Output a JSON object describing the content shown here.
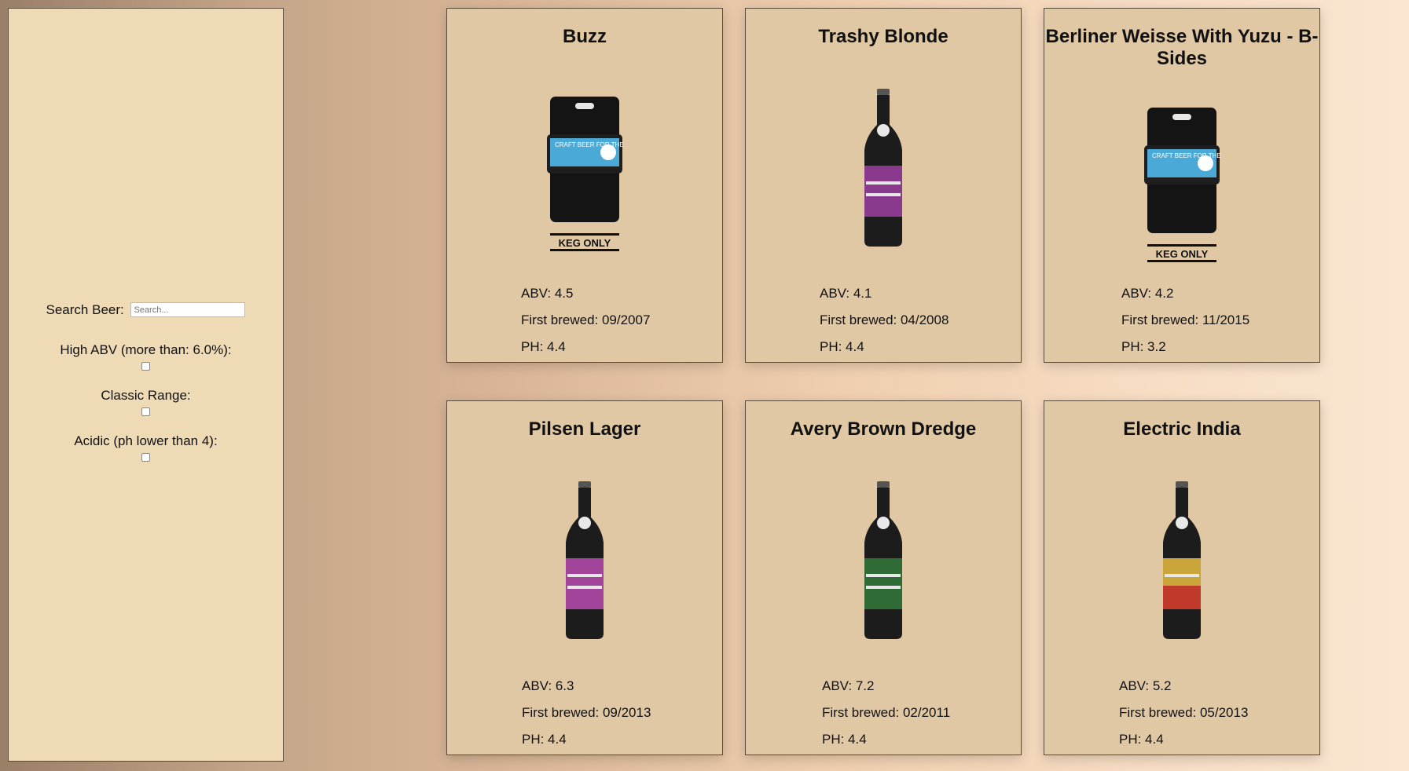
{
  "sidebar": {
    "search_label": "Search Beer:",
    "search_placeholder": "Search...",
    "filters": [
      {
        "label": "High ABV (more than: 6.0%):"
      },
      {
        "label": "Classic Range:"
      },
      {
        "label": "Acidic (ph lower than 4):"
      }
    ]
  },
  "cards": [
    {
      "name": "Buzz",
      "image": "keg-icon",
      "keg_label": "KEG ONLY",
      "keg_text": "CRAFT BEER FOR THE PEOPLE",
      "abv": "ABV: 4.5",
      "brewed": "First brewed: 09/2007",
      "ph": "PH: 4.4"
    },
    {
      "name": "Trashy Blonde",
      "image": "bottle-icon",
      "label_color": "#8a3a8c",
      "abv": "ABV: 4.1",
      "brewed": "First brewed: 04/2008",
      "ph": "PH: 4.4"
    },
    {
      "name": "Berliner Weisse With Yuzu - B-Sides",
      "image": "keg-icon",
      "keg_label": "KEG ONLY",
      "keg_text": "CRAFT BEER FOR THE PEOPLE",
      "abv": "ABV: 4.2",
      "brewed": "First brewed: 11/2015",
      "ph": "PH: 3.2"
    },
    {
      "name": "Pilsen Lager",
      "image": "bottle-icon",
      "label_color": "#a2449a",
      "abv": "ABV: 6.3",
      "brewed": "First brewed: 09/2013",
      "ph": "PH: 4.4"
    },
    {
      "name": "Avery Brown Dredge",
      "image": "bottle-icon",
      "label_color": "#2f6b34",
      "abv": "ABV: 7.2",
      "brewed": "First brewed: 02/2011",
      "ph": "PH: 4.4"
    },
    {
      "name": "Electric India",
      "image": "bottle-icon",
      "label_color": "#c9a53a",
      "abv": "ABV: 5.2",
      "brewed": "First brewed: 05/2013",
      "ph": "PH: 4.4"
    }
  ],
  "colors": {
    "card_bg": "#e1c8a5",
    "sidebar_bg": "#eedbb6",
    "keg_band": "#4aa9d6"
  }
}
